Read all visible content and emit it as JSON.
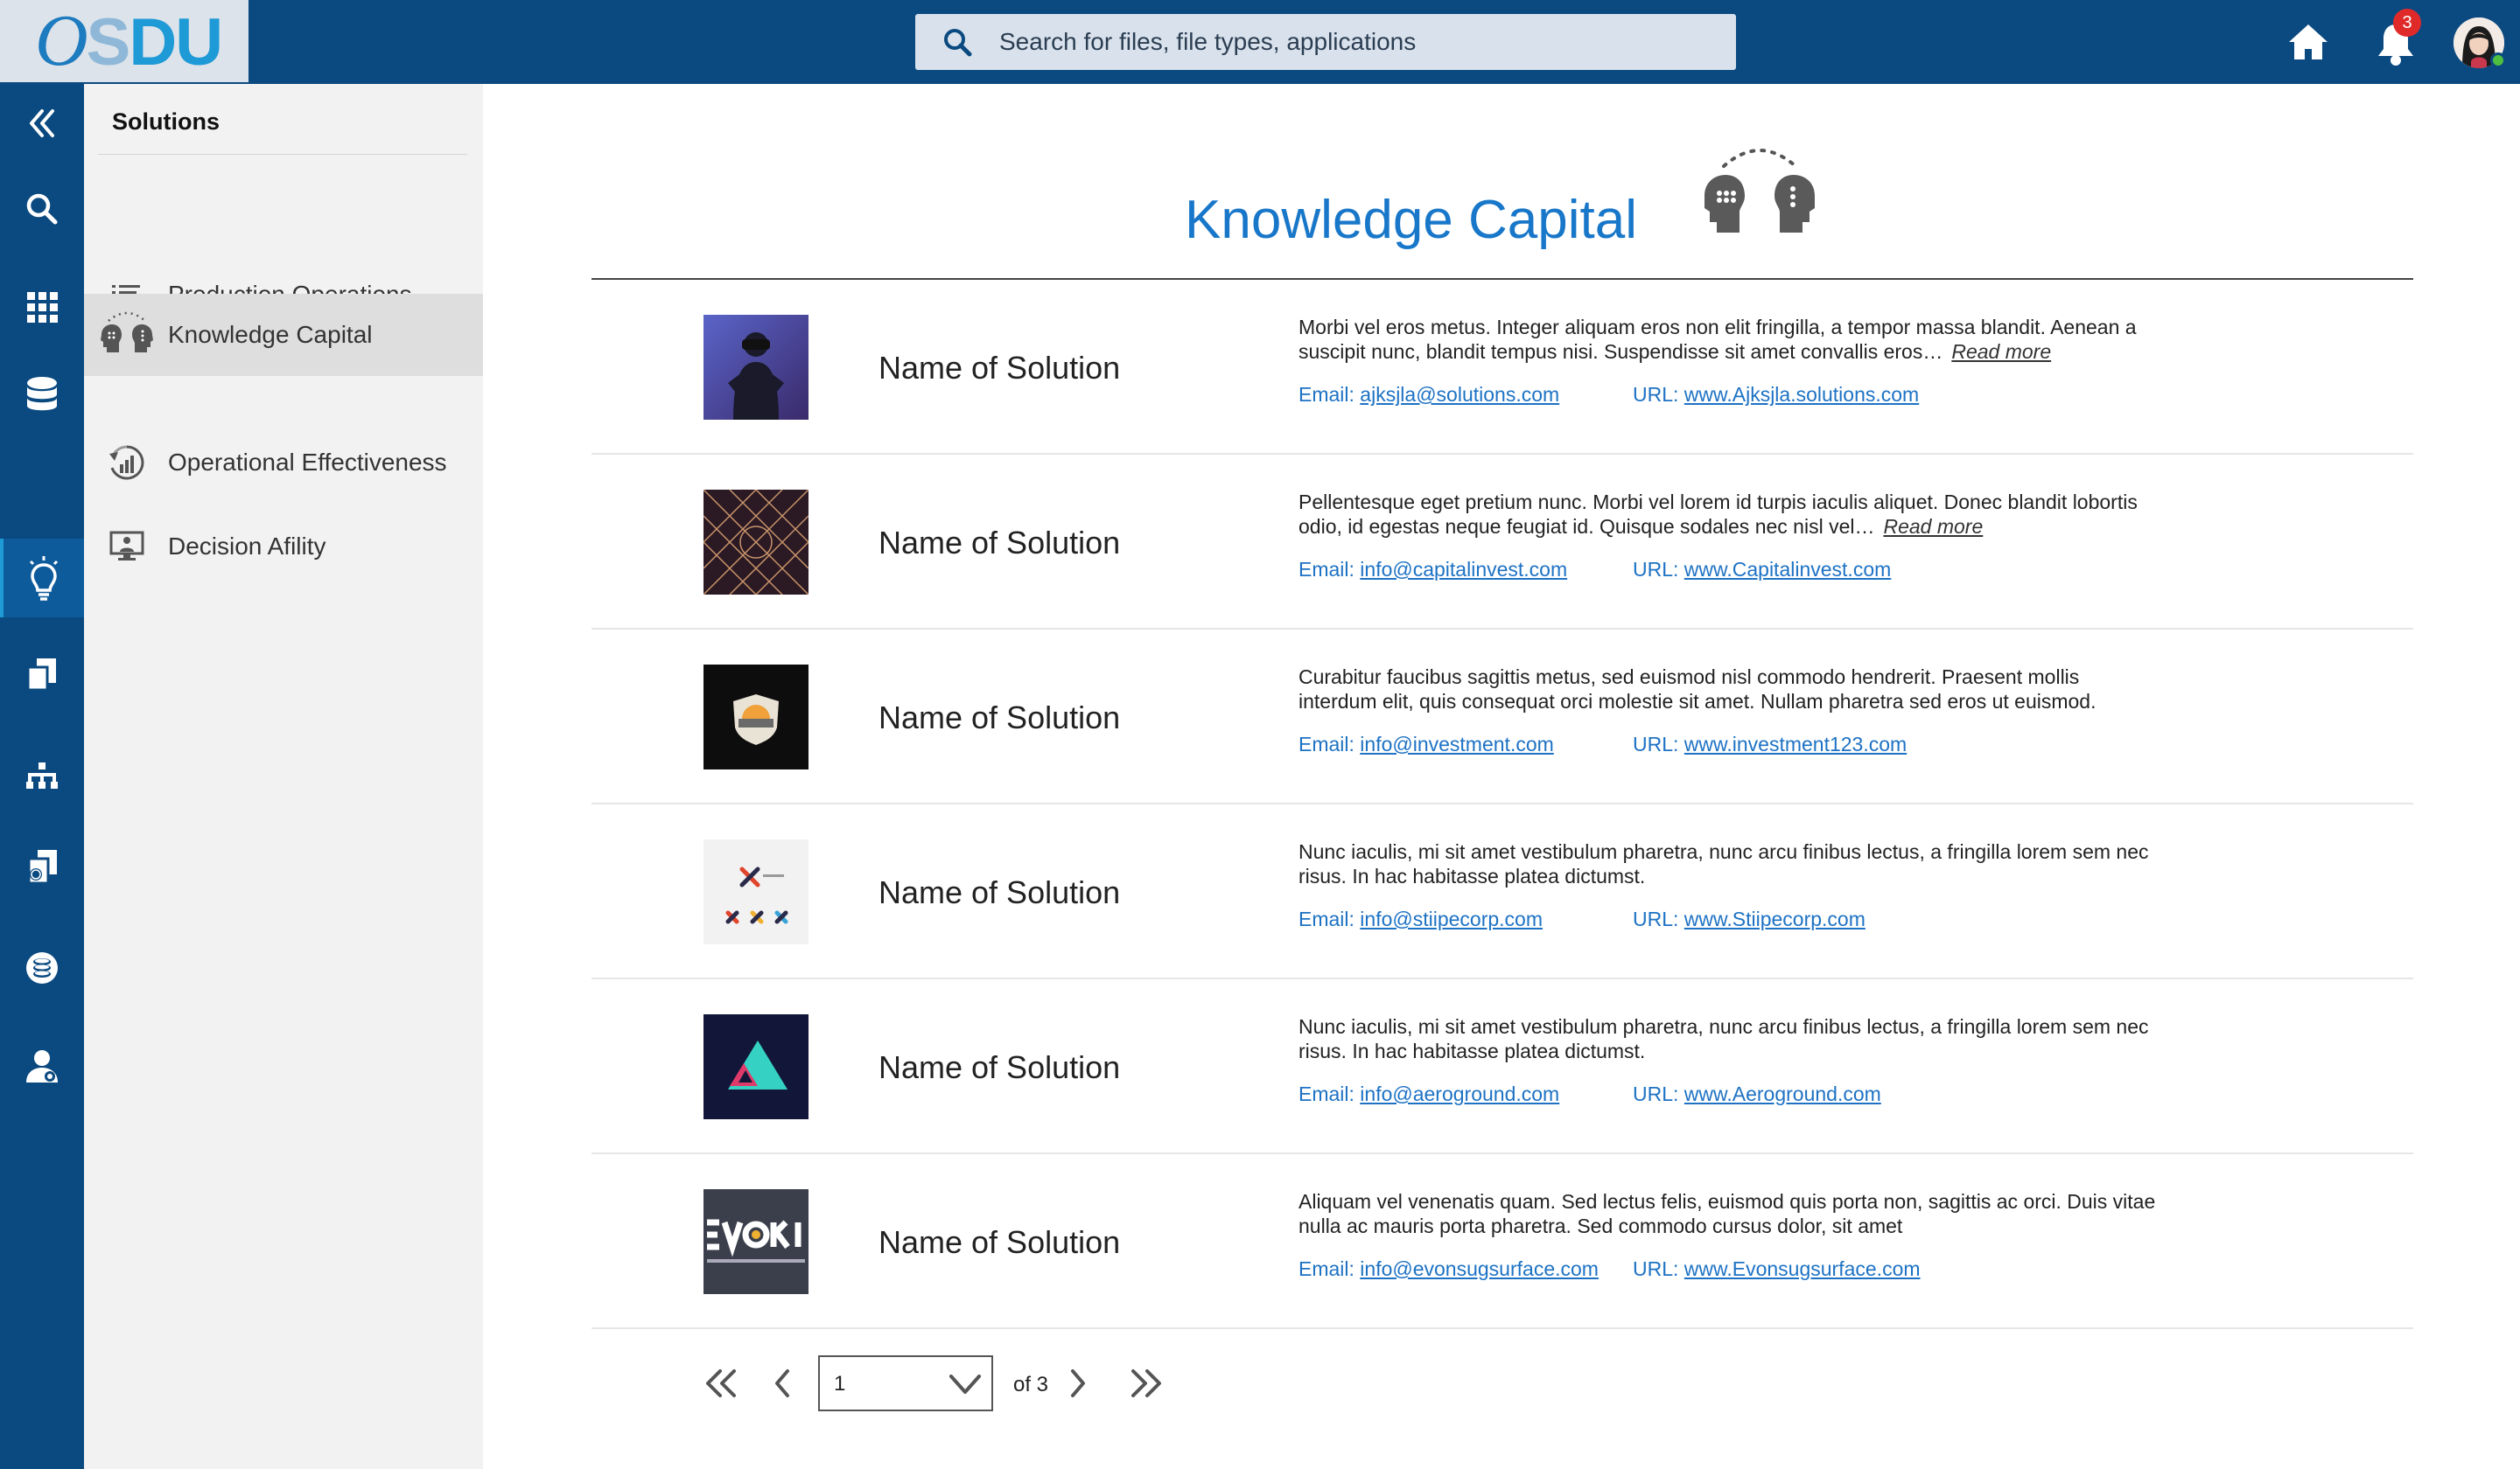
{
  "app": {
    "logo": "OSDU",
    "search_placeholder": "Search for files, file types, applications",
    "notifications_count": "3"
  },
  "colors": {
    "header_bg": "#0b4a80",
    "accent": "#1877c9",
    "link": "#1d72c4",
    "badge": "#e02a2a"
  },
  "rail": {
    "items": [
      "collapse-icon",
      "search-icon",
      "apps-grid-icon",
      "database-icon",
      "lightbulb-icon",
      "documents-icon",
      "hierarchy-icon",
      "file-globe-icon",
      "coins-icon",
      "user-admin-icon"
    ]
  },
  "sidebar": {
    "title": "Solutions",
    "items": [
      {
        "label": "Production Operations",
        "icon": "list-icon"
      },
      {
        "label": "Knowledge Capital",
        "icon": "knowledge-heads-icon"
      },
      {
        "label": "Operational Effectiveness",
        "icon": "cycle-chart-icon"
      },
      {
        "label": "Decision Afility",
        "icon": "monitor-person-icon"
      }
    ]
  },
  "main": {
    "title": "Knowledge Capital",
    "rows": [
      {
        "name": "Name of Solution",
        "desc": "Morbi vel eros metus. Integer aliquam eros non elit fringilla, a tempor massa blandit. Aenean a suscipit nunc, blandit tempus nisi. Suspendisse sit amet convallis eros…",
        "read_more": "Read more",
        "email_label": "Email: ",
        "email": "ajksjla@solutions.com",
        "url_label": "URL: ",
        "url": "www.Ajksjla.solutions.com"
      },
      {
        "name": "Name of Solution",
        "desc": "Pellentesque eget pretium nunc. Morbi vel lorem id turpis iaculis aliquet. Donec blandit lobortis odio, id egestas neque feugiat id. Quisque sodales nec nisl vel…",
        "read_more": "Read more",
        "email_label": "Email: ",
        "email": "info@capitalinvest.com",
        "url_label": "URL: ",
        "url": "www.Capitalinvest.com"
      },
      {
        "name": "Name of Solution",
        "desc": "Curabitur faucibus sagittis metus, sed euismod nisl commodo hendrerit. Praesent mollis interdum elit, quis consequat orci molestie sit amet. Nullam pharetra sed eros ut euismod.",
        "read_more": "",
        "email_label": "Email: ",
        "email": "info@investment.com",
        "url_label": "URL: ",
        "url": "www.investment123.com"
      },
      {
        "name": "Name of Solution",
        "desc": "Nunc iaculis, mi sit amet vestibulum pharetra, nunc arcu finibus lectus, a fringilla lorem sem nec risus. In hac habitasse platea dictumst.",
        "read_more": "",
        "email_label": "Email: ",
        "email": "info@stiipecorp.com",
        "url_label": "URL: ",
        "url": "www.Stiipecorp.com"
      },
      {
        "name": "Name of Solution",
        "desc": "Nunc iaculis, mi sit amet vestibulum pharetra, nunc arcu finibus lectus, a fringilla lorem sem nec risus. In hac habitasse platea dictumst.",
        "read_more": "",
        "email_label": "Email: ",
        "email": "info@aeroground.com",
        "url_label": "URL: ",
        "url": "www.Aeroground.com"
      },
      {
        "name": "Name of Solution",
        "desc": "Aliquam vel venenatis quam. Sed lectus felis, euismod quis porta non, sagittis ac orci. Duis vitae nulla ac mauris porta pharetra. Sed commodo cursus dolor, sit amet",
        "read_more": "",
        "email_label": "Email: ",
        "email": "info@evonsugsurface.com",
        "url_label": "URL: ",
        "url": "www.Evonsugsurface.com"
      }
    ]
  },
  "pager": {
    "current": "1",
    "of_label": "of 3"
  }
}
